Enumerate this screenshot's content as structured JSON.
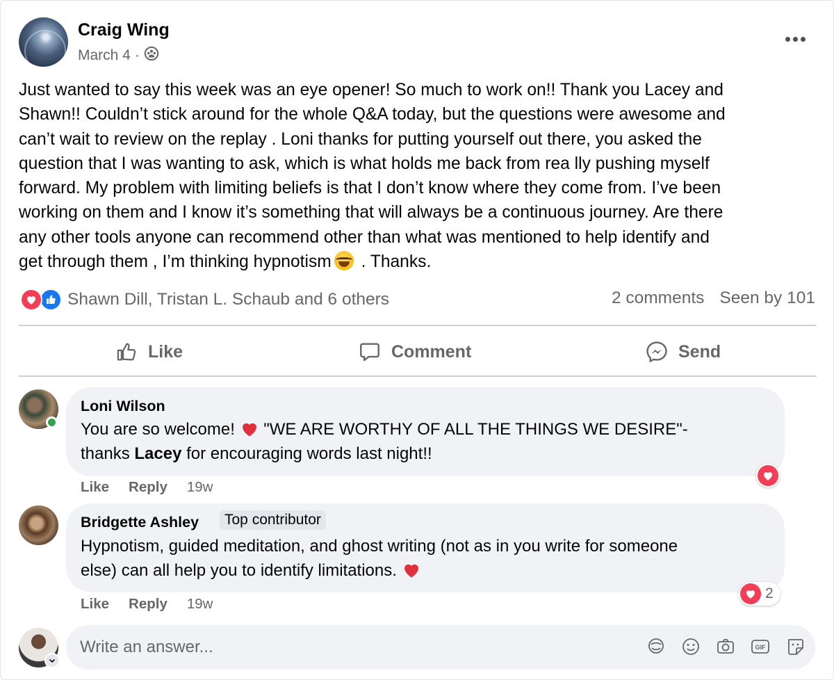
{
  "post": {
    "author": "Craig Wing",
    "date": "March 4",
    "separator": "·",
    "lines": [
      "Just wanted to say this week was an eye opener!  So much to work on!!  Thank you Lacey and",
      "Shawn!!   Couldn’t stick around for the whole Q&A today, but the questions were awesome and",
      "can’t wait to review on the replay  .  Loni thanks for putting yourself out there, you asked the",
      "question that I was wanting to ask, which is what holds me back from rea  lly pushing myself",
      "forward.  My problem with limiting beliefs is that I don’t know where they come from. I’ve been",
      "working on them and I know it’s something that will always be a continuous journey. Are there",
      "any other tools anyone can recommend other than what was mentioned to help identify and"
    ],
    "last_line_before_emoji": "get through them  , I’m thinking hypnotism",
    "last_line_after_emoji": "  .  Thanks.",
    "reaction_names": "Shawn Dill, Tristan L. Schaub and 6 others",
    "comments_count": "2 comments",
    "seen_by": "Seen by 101"
  },
  "actions": {
    "like": "Like",
    "comment": "Comment",
    "send": "Send"
  },
  "comments": [
    {
      "name": "Loni Wilson",
      "line1_before_heart": "You are so welcome!",
      "line1_after_heart": "\"WE ARE WORTHY OF ALL THE THINGS WE DESIRE\"-",
      "line2_pre": "thanks ",
      "line2_bold": "Lacey",
      "line2_post": " for encouraging words last night!!",
      "like": "Like",
      "reply": "Reply",
      "time": "19w"
    },
    {
      "name": "Bridgette Ashley",
      "badge": "Top contributor",
      "line1": "Hypnotism, guided meditation, and ghost writing (not as in you write for someone",
      "line2": "else) can all help you to identify limitations.",
      "like": "Like",
      "reply": "Reply",
      "time": "19w",
      "reaction_count": "2"
    }
  ],
  "composer": {
    "placeholder": "Write an answer..."
  },
  "colors": {
    "love": "#f33e58",
    "like": "#1877f2",
    "secondary_text": "#65676b",
    "bubble": "#f0f2f5",
    "online": "#31a24c"
  },
  "icons": [
    "more-options-icon",
    "members-audience-icon",
    "love-reaction-icon",
    "like-reaction-icon",
    "thumbs-up-icon",
    "comment-icon",
    "messenger-icon",
    "red-heart-emoji-icon",
    "laughing-emoji-icon",
    "avatar-icon",
    "emoji-icon",
    "camera-icon",
    "gif-icon",
    "sticker-icon",
    "chevron-down-icon"
  ]
}
